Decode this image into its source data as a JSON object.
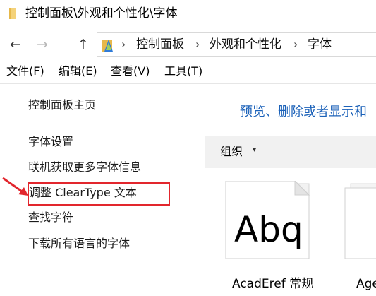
{
  "window": {
    "title": "控制面板\\外观和个性化\\字体"
  },
  "nav": {
    "back_icon": "left-arrow-icon",
    "forward_icon": "right-arrow-icon",
    "up_icon": "up-arrow-icon"
  },
  "address": {
    "crumbs": [
      "控制面板",
      "外观和个性化",
      "字体"
    ]
  },
  "menu": {
    "items": [
      "文件(F)",
      "编辑(E)",
      "查看(V)",
      "工具(T)"
    ]
  },
  "sidebar": {
    "home": "控制面板主页",
    "links": [
      "字体设置",
      "联机获取更多字体信息",
      "调整 ClearType 文本",
      "查找字符",
      "下载所有语言的字体"
    ]
  },
  "main": {
    "heading": "预览、删除或者显示和",
    "toolbar": {
      "organize_label": "组织",
      "organize_caret": "▾"
    },
    "fonts": [
      {
        "name": "AcadEref 常规",
        "preview": "Abq"
      },
      {
        "name": "Age"
      }
    ]
  },
  "colors": {
    "link_blue": "#1c62b9",
    "highlight_red": "#e2262d",
    "toolbar_bg": "#f1f1f1",
    "folder_yellow": "#f0c23a"
  }
}
